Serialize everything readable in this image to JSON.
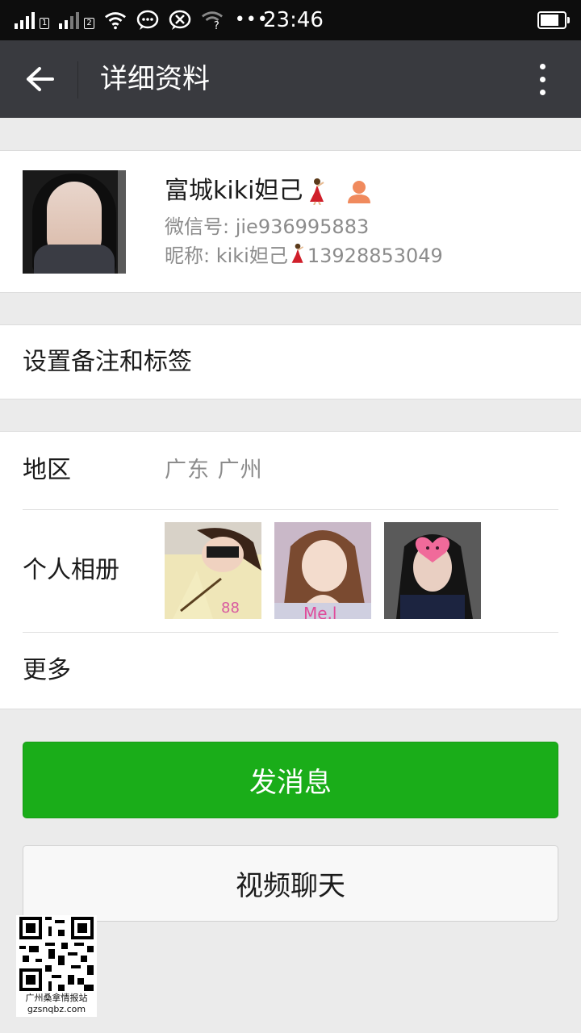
{
  "status_bar": {
    "sim1_badge": "1",
    "sim2_badge": "2",
    "time": "23:46",
    "icons": [
      "signal-icon",
      "wifi-icon",
      "wechat-notification-icon",
      "missed-call-icon",
      "wifi-unknown-icon",
      "more-dots-icon",
      "battery-icon"
    ]
  },
  "header": {
    "title": "详细资料",
    "back_icon": "arrow-left-icon",
    "menu_icon": "vertical-dots-icon"
  },
  "profile": {
    "name": "富城kiki妲己",
    "wechat_id": "微信号: jie936995883",
    "nickname_prefix": "昵称: kiki妲己",
    "nickname_suffix": "13928853049",
    "emoji": "dancer-emoji",
    "contact_icon": "contact-person-icon"
  },
  "remark": {
    "label": "设置备注和标签"
  },
  "info": {
    "region_label": "地区",
    "region_value": "广东  广州",
    "album_label": "个人相册",
    "more_label": "更多"
  },
  "actions": {
    "send_message": "发消息",
    "video_chat": "视频聊天"
  },
  "watermark": {
    "caption_cn": "广州桑拿情报站",
    "caption_url": "gzsnqbz.com"
  },
  "colors": {
    "header_bg": "#393a3f",
    "primary_green": "#1aad19",
    "page_bg": "#ebebeb",
    "contact_icon": "#f08a5d"
  }
}
